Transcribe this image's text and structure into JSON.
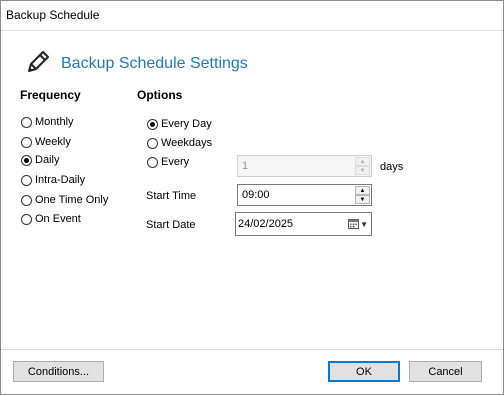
{
  "window": {
    "title": "Backup Schedule"
  },
  "header": {
    "title": "Backup Schedule Settings",
    "icon": "pencil-icon"
  },
  "frequency": {
    "label": "Frequency",
    "options": [
      "Monthly",
      "Weekly",
      "Daily",
      "Intra-Daily",
      "One Time Only",
      "On Event"
    ],
    "selected": "Daily"
  },
  "options": {
    "label": "Options",
    "items": [
      "Every Day",
      "Weekdays",
      "Every"
    ],
    "selected": "Every Day",
    "every_value": "1",
    "days_label": "days"
  },
  "start_time": {
    "label": "Start Time",
    "value": "09:00"
  },
  "start_date": {
    "label": "Start Date",
    "value": "24/02/2025"
  },
  "buttons": {
    "conditions": "Conditions...",
    "ok": "OK",
    "cancel": "Cancel"
  },
  "colors": {
    "accent": "#1e7bbf",
    "default_button_border": "#0078d7"
  }
}
